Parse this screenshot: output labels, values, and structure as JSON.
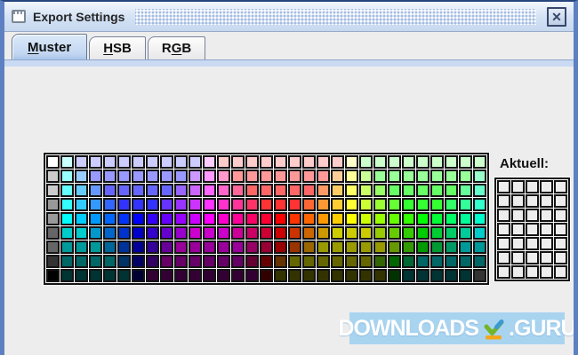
{
  "window": {
    "title": "Export Settings",
    "colors": {
      "frame_border": "#5d80c2",
      "titlebar_gradient_top": "#f2f7fd",
      "titlebar_gradient_bottom": "#c6d8ef",
      "tab_selected_fill": "#c3d7f2",
      "content_bg": "#ededed",
      "grid_border": "#141414"
    }
  },
  "icons": {
    "close": "✕",
    "window": "window-glyph",
    "download": "check-arrow-over-bar"
  },
  "tabs": [
    {
      "name": "Muster",
      "pre": "",
      "mn": "M",
      "post": "uster",
      "selected": true
    },
    {
      "name": "HSB",
      "pre": "",
      "mn": "H",
      "post": "SB",
      "selected": false
    },
    {
      "name": "RGB",
      "pre": "R",
      "mn": "G",
      "post": "B",
      "selected": false
    }
  ],
  "swatch_panel": {
    "recent_label": "Aktuell:",
    "grid_cols": 31,
    "grid_rows": 9,
    "palette_rows": [
      [
        "#ffffff",
        "#ccffff",
        "#ccccff",
        "#ccccff",
        "#ccccff",
        "#ccccff",
        "#ccccff",
        "#ccccff",
        "#ccccff",
        "#ccccff",
        "#ccccff",
        "#ffccff",
        "#ffcccc",
        "#ffcccc",
        "#ffcccc",
        "#ffcccc",
        "#ffcccc",
        "#ffcccc",
        "#ffcccc",
        "#ffcccc",
        "#ffcccc",
        "#ffffcc",
        "#ccffcc",
        "#ccffcc",
        "#ccffcc",
        "#ccffcc",
        "#ccffcc",
        "#ccffcc",
        "#ccffcc",
        "#ccffcc",
        "#ccffcc"
      ],
      [
        "#cccccc",
        "#99ffff",
        "#99ccff",
        "#9999ff",
        "#9999ff",
        "#9999ff",
        "#9999ff",
        "#9999ff",
        "#9999ff",
        "#9999ff",
        "#cc99ff",
        "#ff99ff",
        "#ff99cc",
        "#ff9999",
        "#ff9999",
        "#ff9999",
        "#ff9999",
        "#ff9999",
        "#ff9999",
        "#ff9999",
        "#ffcc99",
        "#ffff99",
        "#ccff99",
        "#99ff99",
        "#99ff99",
        "#99ff99",
        "#99ff99",
        "#99ff99",
        "#99ff99",
        "#99ff99",
        "#99ffcc"
      ],
      [
        "#cccccc",
        "#66ffff",
        "#66ccff",
        "#6699ff",
        "#6666ff",
        "#6666ff",
        "#6666ff",
        "#6666ff",
        "#6666ff",
        "#9966ff",
        "#cc66ff",
        "#ff66ff",
        "#ff66cc",
        "#ff6699",
        "#ff6666",
        "#ff6666",
        "#ff6666",
        "#ff6666",
        "#ff6666",
        "#ff9966",
        "#ffcc66",
        "#ffff66",
        "#ccff66",
        "#99ff66",
        "#66ff66",
        "#66ff66",
        "#66ff66",
        "#66ff66",
        "#66ff66",
        "#66ff99",
        "#66ffcc"
      ],
      [
        "#999999",
        "#33ffff",
        "#33ccff",
        "#3399ff",
        "#3366ff",
        "#3333ff",
        "#3333ff",
        "#3333ff",
        "#6633ff",
        "#9933ff",
        "#cc33ff",
        "#ff33ff",
        "#ff33cc",
        "#ff3399",
        "#ff3366",
        "#ff3333",
        "#ff3333",
        "#ff3333",
        "#ff6633",
        "#ff9933",
        "#ffcc33",
        "#ffff33",
        "#ccff33",
        "#99ff33",
        "#66ff33",
        "#33ff33",
        "#33ff33",
        "#33ff33",
        "#33ff66",
        "#33ff99",
        "#33ffcc"
      ],
      [
        "#999999",
        "#00ffff",
        "#00ccff",
        "#0099ff",
        "#0066ff",
        "#0033ff",
        "#0000ff",
        "#3300ff",
        "#6600ff",
        "#9900ff",
        "#cc00ff",
        "#ff00ff",
        "#ff00cc",
        "#ff0099",
        "#ff0066",
        "#ff0033",
        "#ff0000",
        "#ff3300",
        "#ff6600",
        "#ff9900",
        "#ffcc00",
        "#ffff00",
        "#ccff00",
        "#99ff00",
        "#66ff00",
        "#33ff00",
        "#00ff00",
        "#00ff33",
        "#00ff66",
        "#00ff99",
        "#00ffcc"
      ],
      [
        "#666666",
        "#00cccc",
        "#00cccc",
        "#0099cc",
        "#0066cc",
        "#0033cc",
        "#0000cc",
        "#3300cc",
        "#6600cc",
        "#9900cc",
        "#cc00cc",
        "#cc00cc",
        "#cc00cc",
        "#cc0099",
        "#cc0066",
        "#cc0033",
        "#cc0000",
        "#cc3300",
        "#cc6600",
        "#cc9900",
        "#cccc00",
        "#cccc00",
        "#cccc00",
        "#99cc00",
        "#66cc00",
        "#33cc00",
        "#00cc00",
        "#00cc33",
        "#00cc66",
        "#00cc99",
        "#00cccc"
      ],
      [
        "#666666",
        "#009999",
        "#009999",
        "#009999",
        "#006699",
        "#003399",
        "#000099",
        "#330099",
        "#660099",
        "#990099",
        "#990099",
        "#990099",
        "#990099",
        "#990099",
        "#990066",
        "#990033",
        "#990000",
        "#993300",
        "#996600",
        "#999900",
        "#999900",
        "#999900",
        "#999900",
        "#999900",
        "#669900",
        "#339900",
        "#009900",
        "#009933",
        "#009966",
        "#009999",
        "#009999"
      ],
      [
        "#333333",
        "#006666",
        "#006666",
        "#006666",
        "#006666",
        "#003366",
        "#000066",
        "#330066",
        "#660066",
        "#660066",
        "#660066",
        "#660066",
        "#660066",
        "#660066",
        "#660033",
        "#660000",
        "#663300",
        "#666600",
        "#666600",
        "#666600",
        "#666600",
        "#666600",
        "#666600",
        "#336600",
        "#006600",
        "#006633",
        "#006666",
        "#006666",
        "#006666",
        "#006666",
        "#006666"
      ],
      [
        "#000000",
        "#003333",
        "#003333",
        "#003333",
        "#003333",
        "#003333",
        "#000033",
        "#330033",
        "#330033",
        "#330033",
        "#330033",
        "#330033",
        "#330033",
        "#330033",
        "#330033",
        "#330000",
        "#333300",
        "#333300",
        "#333300",
        "#333300",
        "#333300",
        "#333300",
        "#333300",
        "#333300",
        "#003300",
        "#003333",
        "#003333",
        "#003333",
        "#003333",
        "#003333",
        "#333333"
      ]
    ],
    "recent": {
      "cols": 5,
      "rows": 7,
      "cell_color": "#ededed"
    }
  },
  "watermark": {
    "left_text": "DOWNLOADS",
    "right_text": ".GURU",
    "bg": "#a9d4f0",
    "icon_green": "#72b52c",
    "icon_blue": "#3d9ad1",
    "icon_yellow": "#f2a71b"
  }
}
